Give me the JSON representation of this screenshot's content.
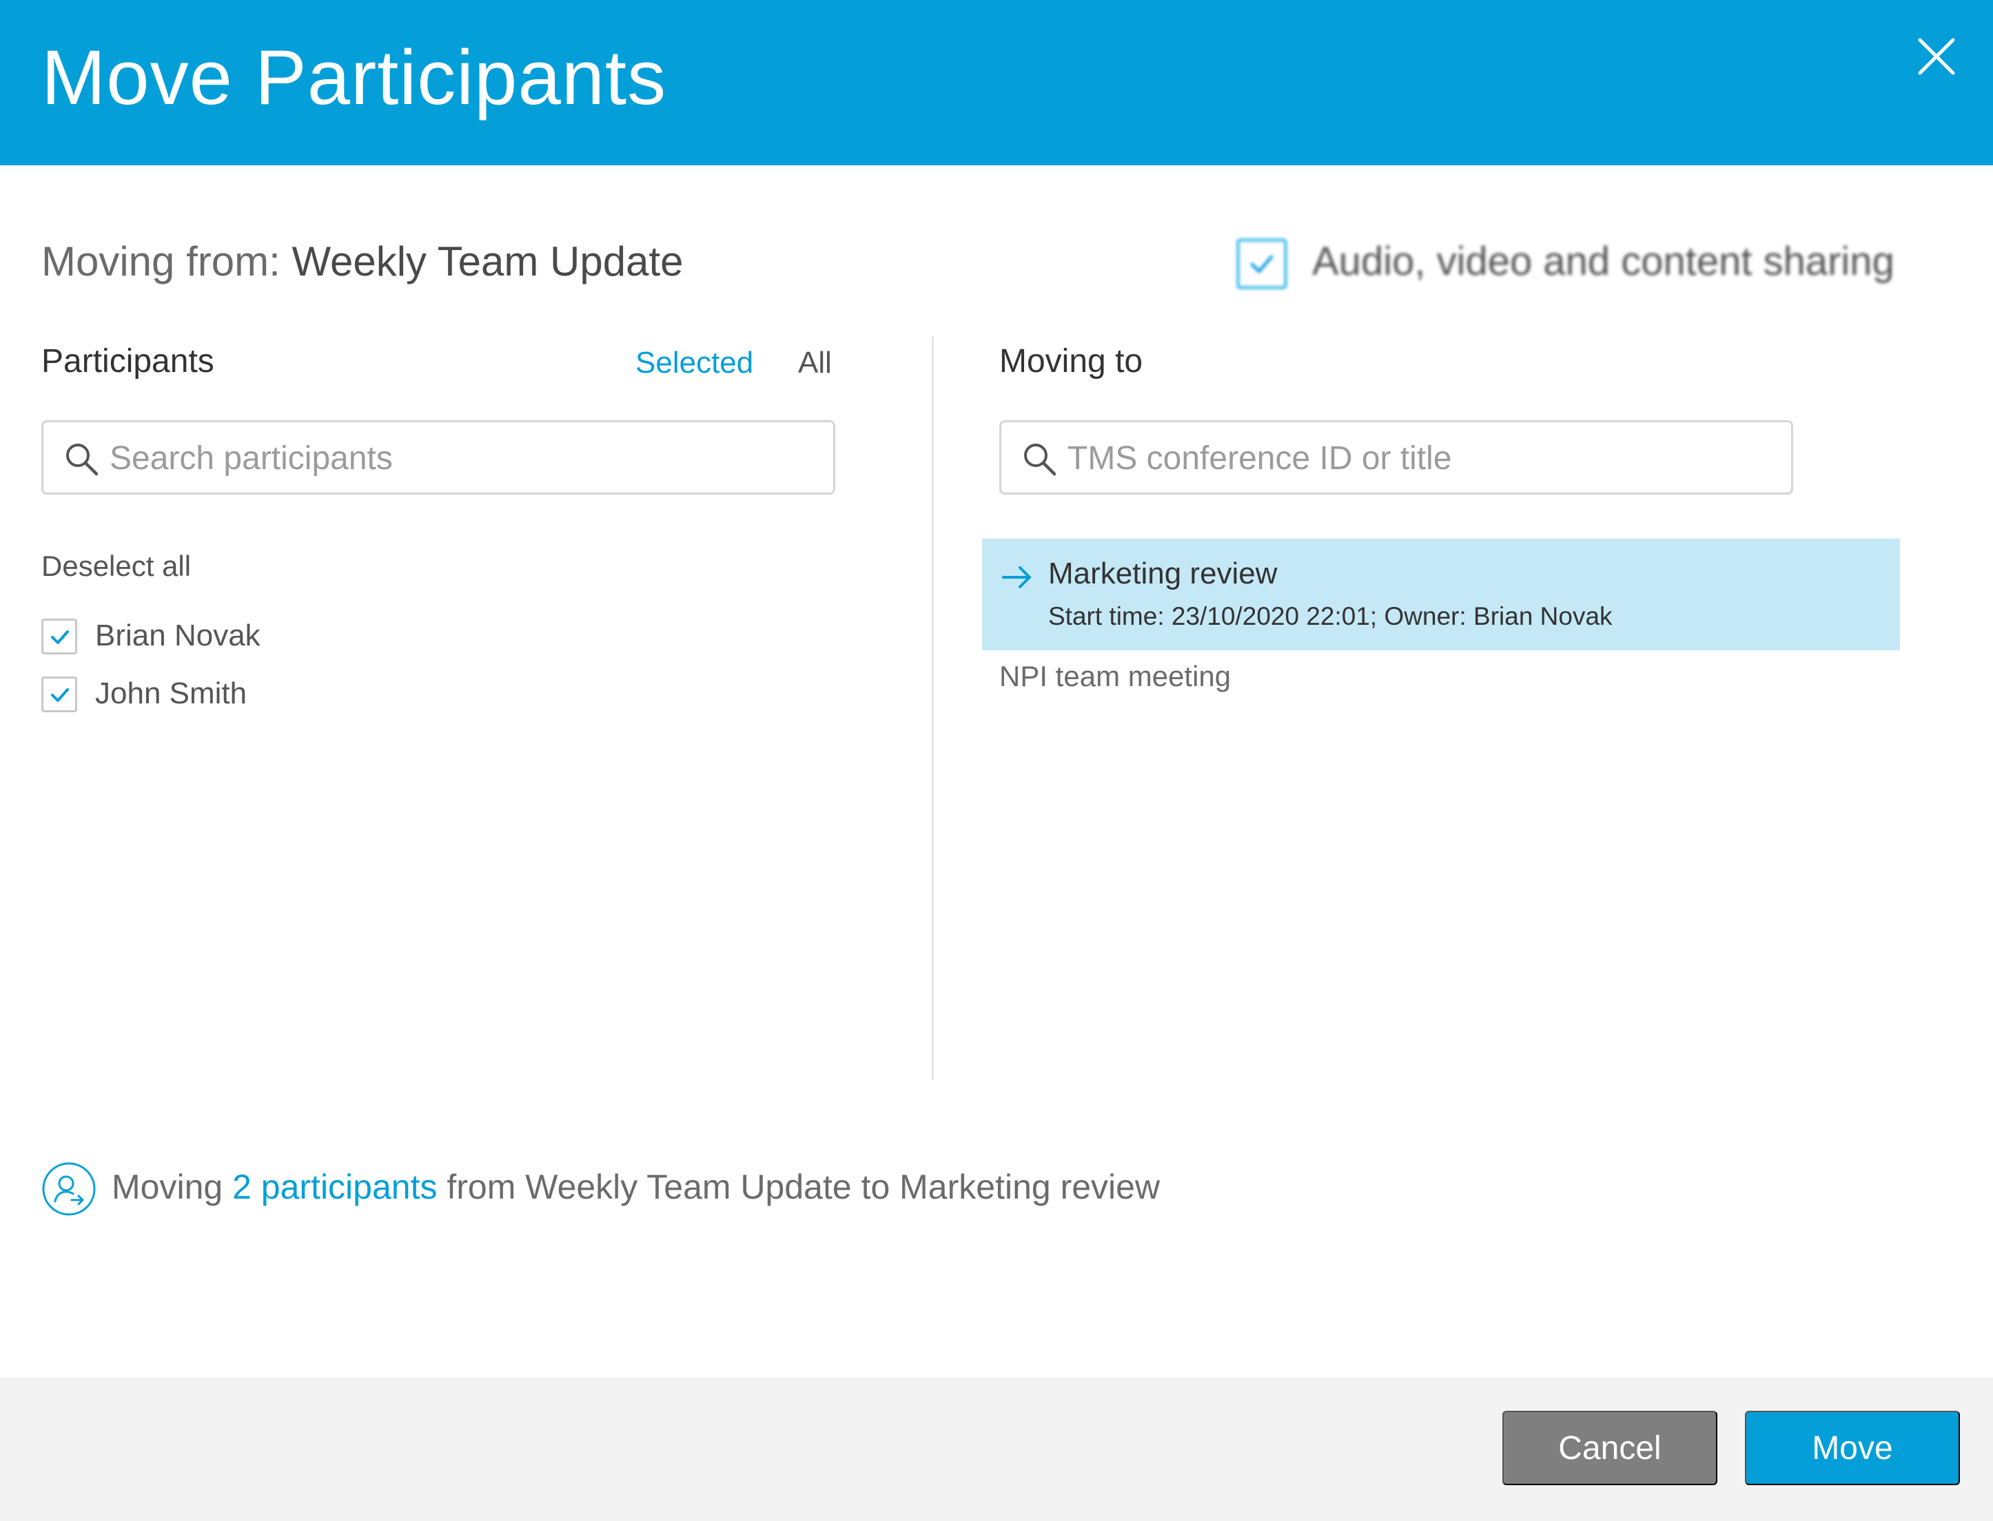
{
  "dialog": {
    "title": "Move Participants"
  },
  "moving_from": {
    "label": "Moving from:",
    "meeting": "Weekly Team Update"
  },
  "media_option": {
    "label": "Audio, video and content sharing",
    "checked": true
  },
  "participants_panel": {
    "title": "Participants",
    "tabs": [
      {
        "label": "Selected",
        "active": true
      },
      {
        "label": "All",
        "active": false
      }
    ],
    "search_placeholder": "Search participants",
    "deselect_label": "Deselect all",
    "items": [
      {
        "name": "Brian Novak",
        "checked": true
      },
      {
        "name": "John Smith",
        "checked": true
      }
    ]
  },
  "moving_to_panel": {
    "title": "Moving to",
    "search_placeholder": "TMS conference ID or title",
    "conferences": [
      {
        "title": "Marketing review",
        "subtitle": "Start time: 23/10/2020 22:01; Owner: Brian Novak",
        "selected": true
      },
      {
        "title": "NPI team meeting",
        "selected": false
      }
    ]
  },
  "summary": {
    "prefix": "Moving",
    "link": "2 participants",
    "suffix": "from Weekly Team Update to Marketing review"
  },
  "footer": {
    "cancel_label": "Cancel",
    "move_label": "Move"
  },
  "colors": {
    "accent": "#049fd9",
    "selected_row": "#c5e8f6",
    "cancel_button": "#7f7f7f",
    "footer_bg": "#f3f3f3"
  },
  "icons": {
    "close": "close-icon",
    "search": "search-icon",
    "check": "checkmark-icon",
    "arrow": "arrow-right-icon",
    "user_move": "user-move-icon"
  }
}
